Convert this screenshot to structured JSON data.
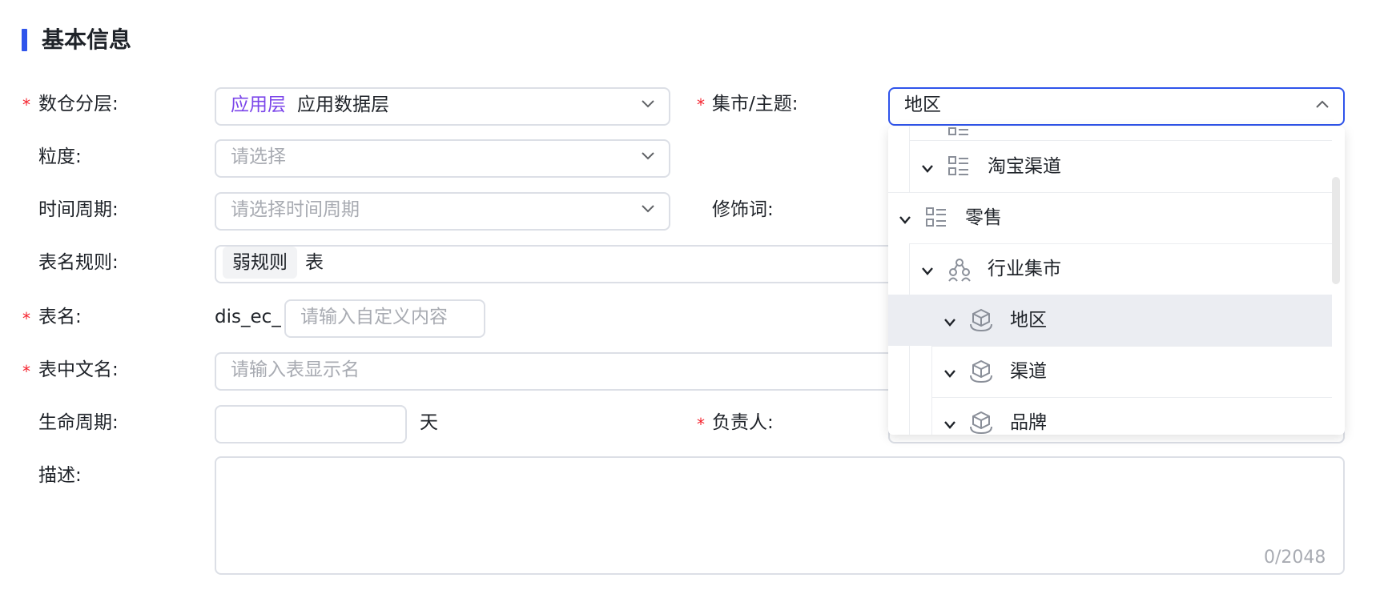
{
  "section": {
    "title": "基本信息"
  },
  "form": {
    "layer": {
      "label": "数仓分层:",
      "tag": "应用层",
      "value": "应用数据层"
    },
    "granularity": {
      "label": "粒度:",
      "placeholder": "请选择"
    },
    "time_period": {
      "label": "时间周期:",
      "placeholder": "请选择时间周期"
    },
    "table_rule": {
      "label": "表名规则:",
      "chip": "弱规则",
      "value": "表"
    },
    "table_name": {
      "label": "表名:",
      "prefix": "dis_ec_",
      "placeholder": "请输入自定义内容"
    },
    "table_cn_name": {
      "label": "表中文名:",
      "placeholder": "请输入表显示名"
    },
    "lifecycle": {
      "label": "生命周期:",
      "value": "",
      "unit": "天"
    },
    "description": {
      "label": "描述:",
      "counter": "0/2048"
    },
    "mart_topic": {
      "label": "集市/主题:",
      "value": "地区"
    },
    "modifier": {
      "label": "修饰词:"
    },
    "owner": {
      "label": "负责人:"
    }
  },
  "dropdown": {
    "items": [
      {
        "label": "淘宝渠道",
        "icon": "list-icon"
      },
      {
        "label": "零售",
        "icon": "list-icon"
      },
      {
        "label": "行业集市",
        "icon": "org-icon"
      },
      {
        "label": "地区",
        "icon": "cube-icon",
        "selected": true
      },
      {
        "label": "渠道",
        "icon": "cube-icon"
      },
      {
        "label": "品牌",
        "icon": "cube-icon"
      }
    ]
  },
  "colors": {
    "accent": "#2f54eb",
    "required": "#f5222d",
    "layer_tag": "#7b45ea"
  }
}
